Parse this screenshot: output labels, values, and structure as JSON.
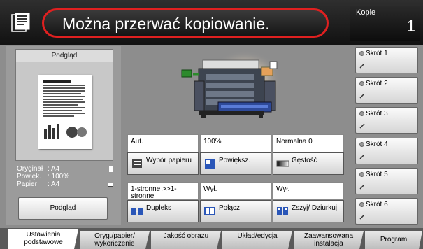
{
  "header": {
    "status_message": "Można przerwać kopiowanie.",
    "copies_label": "Kopie",
    "copies_value": "1"
  },
  "preview_panel": {
    "title": "Podgląd",
    "info": [
      {
        "key": "Oryginał",
        "value": ": A4"
      },
      {
        "key": "Powięk.",
        "value": ": 100%"
      },
      {
        "key": "Papier",
        "value": ": A4"
      }
    ],
    "preview_button": "Podgląd"
  },
  "functions": [
    {
      "value": "Aut.",
      "button": "Wybór papieru",
      "icon": "paper-tray-icon"
    },
    {
      "value": "100%",
      "button": "Powiększ.",
      "icon": "zoom-icon"
    },
    {
      "value": "Normalna 0",
      "button": "Gęstość",
      "icon": "density-icon"
    },
    {
      "value": "1-stronne >>1-stronne",
      "button": "Dupleks",
      "icon": "duplex-icon"
    },
    {
      "value": "Wył.",
      "button": "Połącz",
      "icon": "combine-icon"
    },
    {
      "value": "Wył.",
      "button": "Zszyj/ Dziurkuj",
      "icon": "staple-icon"
    }
  ],
  "shortcuts": [
    "Skrót 1",
    "Skrót 2",
    "Skrót 3",
    "Skrót 4",
    "Skrót 5",
    "Skrót 6"
  ],
  "tabs": [
    {
      "label": "Ustawienia podstawowe",
      "active": true
    },
    {
      "label": "Oryg./papier/ wykończenie",
      "active": false
    },
    {
      "label": "Jakość obrazu",
      "active": false
    },
    {
      "label": "Układ/edycja",
      "active": false
    },
    {
      "label": "Zaawansowana instalacja",
      "active": false
    },
    {
      "label": "Program",
      "active": false
    }
  ],
  "colors": {
    "status_border": "#e02020",
    "header_bg": "#1a1a1a",
    "screen_bg": "#8d8d8d"
  }
}
